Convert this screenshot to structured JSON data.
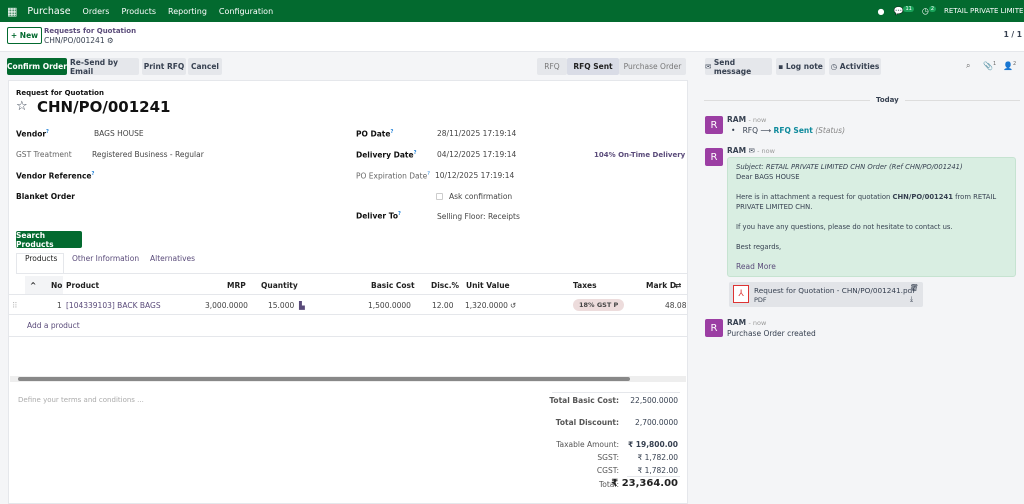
{
  "nav": {
    "app": "Purchase",
    "menu": [
      "Orders",
      "Products",
      "Reporting",
      "Configuration"
    ],
    "chat_count": "11",
    "activity_count": "2",
    "company": "RETAIL PRIVATE LIMITED"
  },
  "control": {
    "new_label": "New",
    "breadcrumb_parent": "Requests for Quotation",
    "breadcrumb_current": "CHN/PO/001241",
    "pager": "1 / 1"
  },
  "actions": {
    "confirm": "Confirm Order",
    "resend": "Re-Send by Email",
    "print": "Print RFQ",
    "cancel": "Cancel"
  },
  "status": {
    "steps": [
      "RFQ",
      "RFQ Sent",
      "Purchase Order"
    ],
    "current": "RFQ Sent"
  },
  "chatter_buttons": {
    "send": "Send message",
    "log": "Log note",
    "activities": "Activities",
    "attachments": "1",
    "followers": "2"
  },
  "form": {
    "subtitle": "Request for Quotation",
    "title": "CHN/PO/001241",
    "vendor_label": "Vendor",
    "vendor": "BAGS HOUSE",
    "gst_label": "GST Treatment",
    "gst": "Registered Business - Regular",
    "vendor_ref_label": "Vendor Reference",
    "blanket_label": "Blanket Order",
    "po_date_label": "PO Date",
    "po_date": "28/11/2025 17:19:14",
    "delivery_label": "Delivery Date",
    "delivery": "04/12/2025 17:19:14",
    "ontime": "104% On-Time Delivery",
    "expiry_label": "PO Expiration Date",
    "expiry": "10/12/2025 17:19:14",
    "ask_confirmation": "Ask confirmation",
    "deliver_to_label": "Deliver To",
    "deliver_to": "Selling Floor: Receipts",
    "search_products": "Search Products",
    "tabs": [
      "Products",
      "Other Information",
      "Alternatives"
    ]
  },
  "table": {
    "headers": [
      "No",
      "Product",
      "MRP",
      "Quantity",
      "Basic Cost",
      "Disc.%",
      "Unit Value",
      "Taxes",
      "Mark D"
    ],
    "rows": [
      {
        "no": "1",
        "product": "[104339103] BACK BAGS",
        "mrp": "3,000.0000",
        "qty": "15.000",
        "basic": "1,500.0000",
        "disc": "12.00",
        "unit": "1,320.0000",
        "tax": "18% GST P",
        "mark": "48.08"
      }
    ],
    "add": "Add a product"
  },
  "terms_placeholder": "Define your terms and conditions ...",
  "totals": [
    {
      "label": "Total Basic Cost:",
      "value": "22,500.0000"
    },
    {
      "label": "Total Discount:",
      "value": "2,700.0000"
    },
    {
      "label": "Taxable Amount:",
      "value": "₹ 19,800.00"
    },
    {
      "label": "SGST:",
      "value": "₹ 1,782.00"
    },
    {
      "label": "CGST:",
      "value": "₹ 1,782.00"
    },
    {
      "label": "Total:",
      "value": "₹ 23,364.00"
    }
  ],
  "chatter": {
    "today": "Today",
    "msg1": {
      "author": "RAM",
      "time": "- now",
      "from": "RFQ",
      "to": "RFQ Sent",
      "field": "(Status)"
    },
    "msg2": {
      "author": "RAM",
      "time": "- now",
      "subject": "Subject: RETAIL PRIVATE LIMITED CHN Order (Ref CHN/PO/001241)",
      "greeting": "Dear BAGS HOUSE",
      "body_pre": "Here is in attachment a request for quotation ",
      "body_bold": "CHN/PO/001241",
      "body_post": " from RETAIL PRIVATE LIMITED CHN.",
      "body2": "If you have any questions, please do not hesitate to contact us.",
      "regards": "Best regards,",
      "read_more": "Read More",
      "attachment": "Request for Quotation - CHN/PO/001241.pdf",
      "attachment_type": "PDF"
    },
    "msg3": {
      "author": "RAM",
      "time": "- now",
      "text": "Purchase Order created"
    },
    "avatar_letter": "R"
  }
}
